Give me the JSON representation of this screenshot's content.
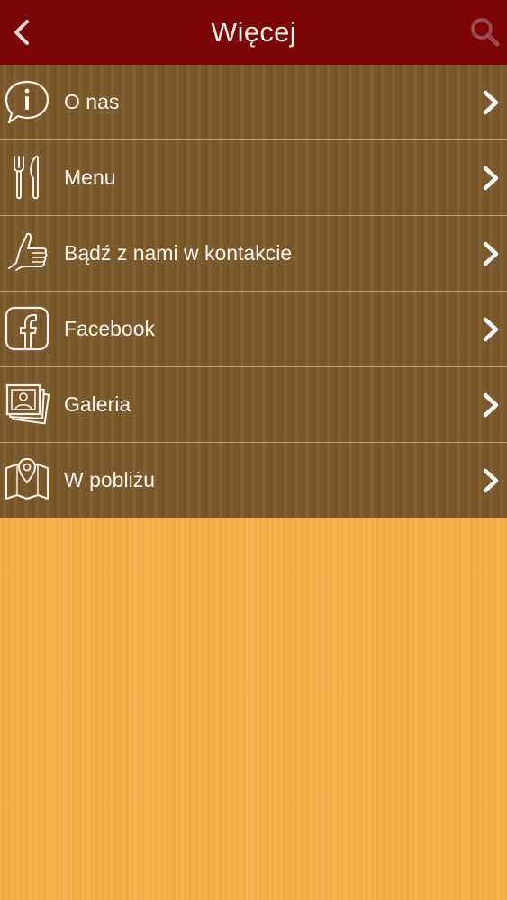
{
  "header": {
    "title": "Więcej",
    "back_icon": "chevron-left-icon",
    "search_icon": "search-icon",
    "bar_color": "#7b0507"
  },
  "menu": {
    "items": [
      {
        "label": "O nas",
        "icon": "info-bubble-icon"
      },
      {
        "label": "Menu",
        "icon": "fork-knife-icon"
      },
      {
        "label": "Bądź z nami w kontakcie",
        "icon": "thumbs-up-icon"
      },
      {
        "label": "Facebook",
        "icon": "facebook-icon"
      },
      {
        "label": "Galeria",
        "icon": "photo-gallery-icon"
      },
      {
        "label": "W pobliżu",
        "icon": "map-pin-icon"
      }
    ],
    "chevron_icon": "chevron-right-icon"
  },
  "colors": {
    "list_background": "#7d5a2d",
    "page_background": "#f4ae4a",
    "text": "#fbf6ee"
  }
}
